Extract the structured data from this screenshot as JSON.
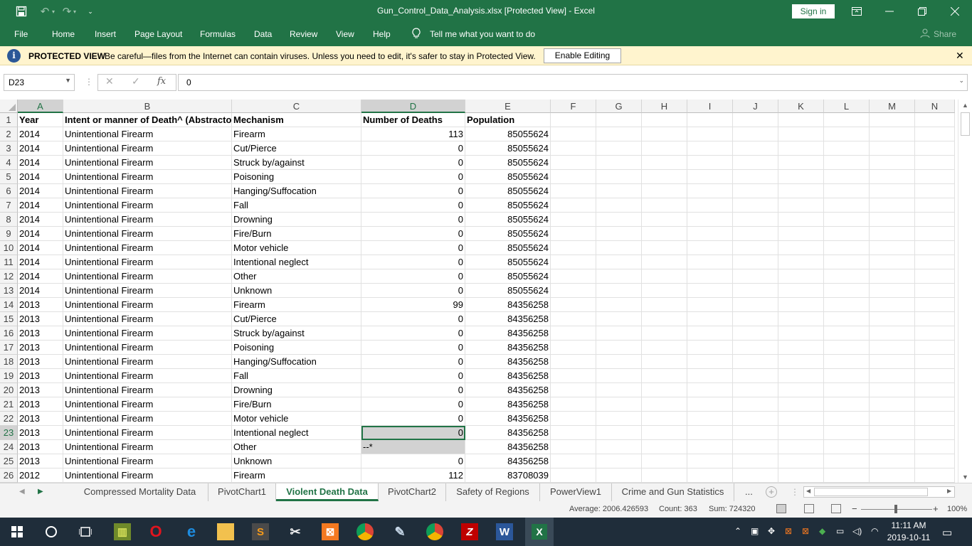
{
  "app": {
    "window_title": "Gun_Control_Data_Analysis.xlsx  [Protected View]  -  Excel",
    "sign_in": "Sign in",
    "accent": "#217346"
  },
  "ribbon": {
    "tabs": [
      "File",
      "Home",
      "Insert",
      "Page Layout",
      "Formulas",
      "Data",
      "Review",
      "View",
      "Help"
    ],
    "tell_me": "Tell me what you want to do",
    "share": "Share"
  },
  "protected_view": {
    "title": "PROTECTED VIEW",
    "message": "Be careful—files from the Internet can contain viruses. Unless you need to edit, it's safer to stay in Protected View.",
    "enable_button": "Enable Editing",
    "bg_color": "#fff4ce"
  },
  "formula_bar": {
    "name_box": "D23",
    "formula": "0",
    "fx": "fx"
  },
  "sheet": {
    "columns": [
      "A",
      "B",
      "C",
      "D",
      "E",
      "F",
      "G",
      "H",
      "I",
      "J",
      "K",
      "L",
      "M",
      "N"
    ],
    "selected_columns": [
      "A",
      "D"
    ],
    "header_row": {
      "num": "1",
      "A": "Year",
      "B": "Intent or manner of Death^ (Abstracto",
      "C": "Mechanism",
      "D": "Number of Deaths",
      "E": "Population"
    },
    "rows": [
      {
        "num": "2",
        "A": "2014",
        "B": "Unintentional Firearm",
        "C": "Firearm",
        "D": "113",
        "E": "85055624"
      },
      {
        "num": "3",
        "A": "2014",
        "B": "Unintentional Firearm",
        "C": "Cut/Pierce",
        "D": "0",
        "E": "85055624"
      },
      {
        "num": "4",
        "A": "2014",
        "B": "Unintentional Firearm",
        "C": "Struck by/against",
        "D": "0",
        "E": "85055624"
      },
      {
        "num": "5",
        "A": "2014",
        "B": "Unintentional Firearm",
        "C": "Poisoning",
        "D": "0",
        "E": "85055624"
      },
      {
        "num": "6",
        "A": "2014",
        "B": "Unintentional Firearm",
        "C": "Hanging/Suffocation",
        "D": "0",
        "E": "85055624"
      },
      {
        "num": "7",
        "A": "2014",
        "B": "Unintentional Firearm",
        "C": "Fall",
        "D": "0",
        "E": "85055624"
      },
      {
        "num": "8",
        "A": "2014",
        "B": "Unintentional Firearm",
        "C": "Drowning",
        "D": "0",
        "E": "85055624"
      },
      {
        "num": "9",
        "A": "2014",
        "B": "Unintentional Firearm",
        "C": "Fire/Burn",
        "D": "0",
        "E": "85055624"
      },
      {
        "num": "10",
        "A": "2014",
        "B": "Unintentional Firearm",
        "C": "Motor vehicle",
        "D": "0",
        "E": "85055624"
      },
      {
        "num": "11",
        "A": "2014",
        "B": "Unintentional Firearm",
        "C": "Intentional neglect",
        "D": "0",
        "E": "85055624"
      },
      {
        "num": "12",
        "A": "2014",
        "B": "Unintentional Firearm",
        "C": "Other",
        "D": "0",
        "E": "85055624"
      },
      {
        "num": "13",
        "A": "2014",
        "B": "Unintentional Firearm",
        "C": "Unknown",
        "D": "0",
        "E": "85055624"
      },
      {
        "num": "14",
        "A": "2013",
        "B": "Unintentional Firearm",
        "C": "Firearm",
        "D": "99",
        "E": "84356258"
      },
      {
        "num": "15",
        "A": "2013",
        "B": "Unintentional Firearm",
        "C": "Cut/Pierce",
        "D": "0",
        "E": "84356258"
      },
      {
        "num": "16",
        "A": "2013",
        "B": "Unintentional Firearm",
        "C": "Struck by/against",
        "D": "0",
        "E": "84356258"
      },
      {
        "num": "17",
        "A": "2013",
        "B": "Unintentional Firearm",
        "C": "Poisoning",
        "D": "0",
        "E": "84356258"
      },
      {
        "num": "18",
        "A": "2013",
        "B": "Unintentional Firearm",
        "C": "Hanging/Suffocation",
        "D": "0",
        "E": "84356258"
      },
      {
        "num": "19",
        "A": "2013",
        "B": "Unintentional Firearm",
        "C": "Fall",
        "D": "0",
        "E": "84356258"
      },
      {
        "num": "20",
        "A": "2013",
        "B": "Unintentional Firearm",
        "C": "Drowning",
        "D": "0",
        "E": "84356258"
      },
      {
        "num": "21",
        "A": "2013",
        "B": "Unintentional Firearm",
        "C": "Fire/Burn",
        "D": "0",
        "E": "84356258"
      },
      {
        "num": "22",
        "A": "2013",
        "B": "Unintentional Firearm",
        "C": "Motor vehicle",
        "D": "0",
        "E": "84356258"
      },
      {
        "num": "23",
        "A": "2013",
        "B": "Unintentional Firearm",
        "C": "Intentional neglect",
        "D": "0",
        "E": "84356258"
      },
      {
        "num": "24",
        "A": "2013",
        "B": "Unintentional Firearm",
        "C": "Other",
        "D": "--*",
        "E": "84356258"
      },
      {
        "num": "25",
        "A": "2013",
        "B": "Unintentional Firearm",
        "C": "Unknown",
        "D": "0",
        "E": "84356258"
      },
      {
        "num": "26",
        "A": "2012",
        "B": "Unintentional Firearm",
        "C": "Firearm",
        "D": "112",
        "E": "83708039"
      }
    ],
    "active_cell_row": "23",
    "highlighted_d_row": "24"
  },
  "sheet_tabs": {
    "tabs": [
      "Compressed Mortality Data",
      "PivotChart1",
      "Violent Death Data",
      "PivotChart2",
      "Safety of Regions",
      "PowerView1",
      "Crime and Gun Statistics"
    ],
    "active": "Violent Death Data",
    "more": "..."
  },
  "status": {
    "average": "Average: 2006.426593",
    "count": "Count: 363",
    "sum": "Sum: 724320",
    "zoom": "100%"
  },
  "taskbar": {
    "time": "11:11 AM",
    "date": "2019-10-11",
    "apps": [
      "file-manager-icon",
      "opera-icon",
      "edge-icon",
      "folder-icon",
      "sublime-icon",
      "snip-icon",
      "xampp-icon",
      "chrome-icon",
      "paint-icon",
      "chrome-icon",
      "filezilla-icon",
      "word-icon",
      "excel-icon"
    ]
  }
}
